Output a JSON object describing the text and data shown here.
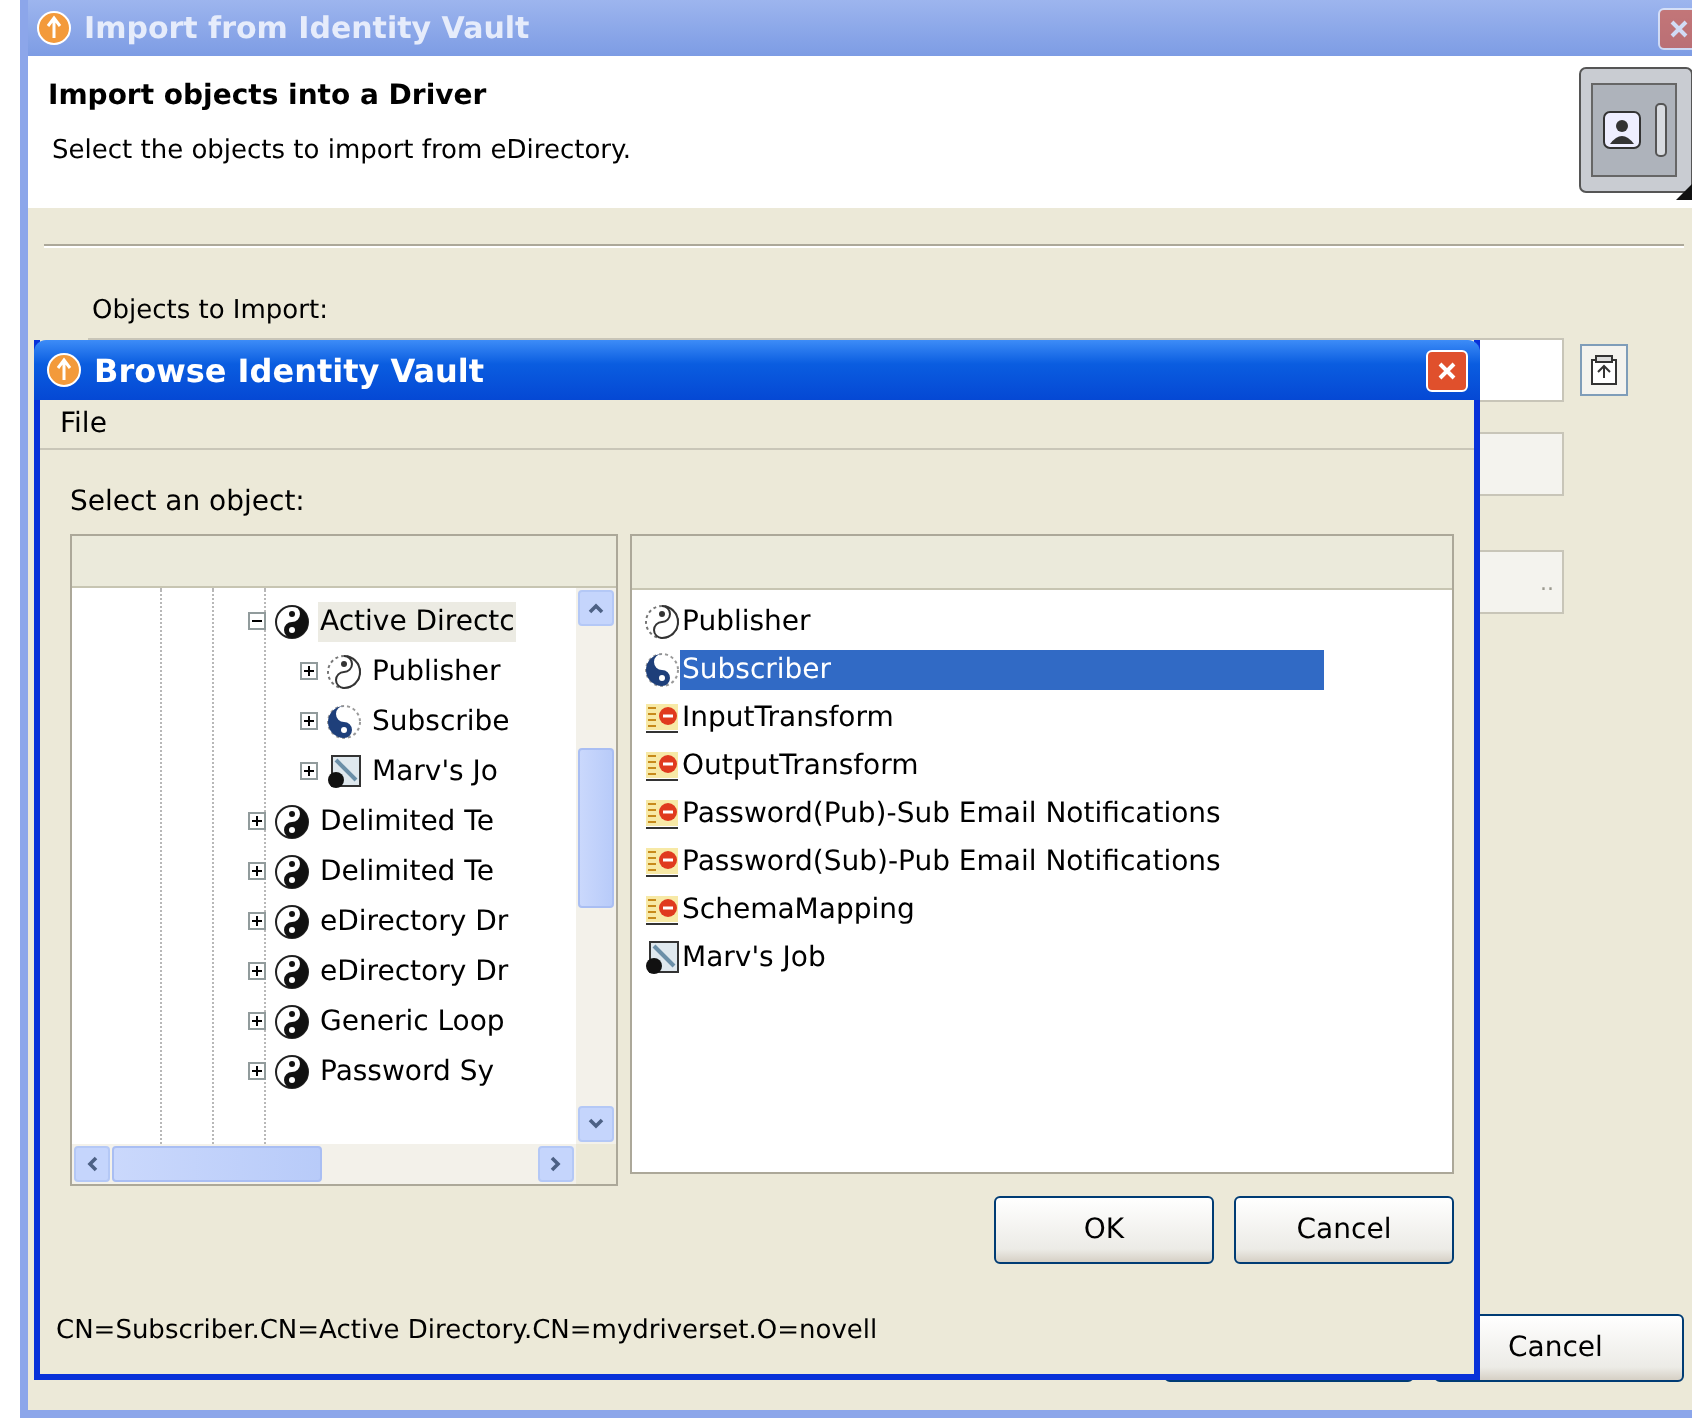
{
  "window": {
    "title": "Import from Identity Vault"
  },
  "header": {
    "title": "Import objects into a Driver",
    "subtitle": "Select the objects to import from eDirectory."
  },
  "objects_label": "Objects to Import:",
  "partial_button": "..",
  "outer_buttons": [
    "Cancel"
  ],
  "dialog": {
    "title": "Browse Identity Vault",
    "menu": [
      "File"
    ],
    "prompt": "Select an object:",
    "tree": [
      {
        "label": "Active Directc",
        "kind": "driver",
        "expanded": true,
        "selected": true,
        "children": [
          {
            "label": "Publisher",
            "kind": "publisher",
            "expanded": false,
            "selected": false
          },
          {
            "label": "Subscribe",
            "kind": "subscriber",
            "expanded": false,
            "selected": false
          },
          {
            "label": "Marv's Jo",
            "kind": "job",
            "expanded": false,
            "selected": false
          }
        ]
      },
      {
        "label": "Delimited Te",
        "kind": "driver",
        "expanded": false,
        "selected": false
      },
      {
        "label": "Delimited Te",
        "kind": "driver",
        "expanded": false,
        "selected": false
      },
      {
        "label": "eDirectory Dr",
        "kind": "driver",
        "expanded": false,
        "selected": false
      },
      {
        "label": "eDirectory Dr",
        "kind": "driver",
        "expanded": false,
        "selected": false
      },
      {
        "label": "Generic Loop",
        "kind": "driver",
        "expanded": false,
        "selected": false
      },
      {
        "label": "Password Sy",
        "kind": "driver",
        "expanded": false,
        "selected": false
      }
    ],
    "list": [
      {
        "label": "Publisher",
        "kind": "publisher",
        "selected": false
      },
      {
        "label": "Subscriber",
        "kind": "subscriber",
        "selected": true
      },
      {
        "label": "InputTransform",
        "kind": "policy",
        "selected": false
      },
      {
        "label": "OutputTransform",
        "kind": "policy",
        "selected": false
      },
      {
        "label": "Password(Pub)-Sub Email Notifications",
        "kind": "policy",
        "selected": false
      },
      {
        "label": "Password(Sub)-Pub Email Notifications",
        "kind": "policy",
        "selected": false
      },
      {
        "label": "SchemaMapping",
        "kind": "policy",
        "selected": false
      },
      {
        "label": "Marv's Job",
        "kind": "job",
        "selected": false
      }
    ],
    "buttons": [
      "OK",
      "Cancel"
    ],
    "status": "CN=Subscriber.CN=Active Directory.CN=mydriverset.O=novell"
  }
}
